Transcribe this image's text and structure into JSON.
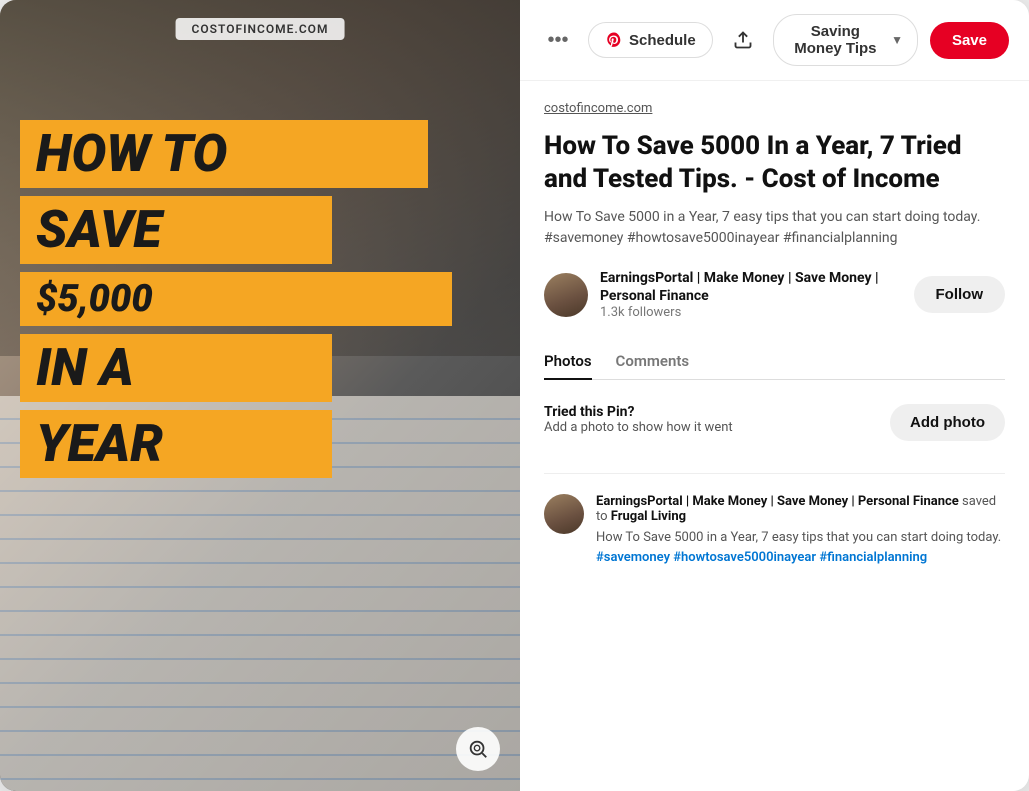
{
  "modal": {
    "image_panel": {
      "site_label": "COSTOFINCOME.COM",
      "text_lines": [
        "HOW TO",
        "SAVE",
        "$5,000",
        "IN A",
        "YEAR"
      ]
    },
    "top_bar": {
      "more_dots": "•••",
      "schedule_label": "Schedule",
      "board_name": "Saving Money Tips",
      "save_label": "Save"
    },
    "source_link": "costofincome.com",
    "pin_title": "How To Save 5000 In a Year, 7 Tried and Tested Tips. - Cost of Income",
    "pin_description": "How To Save 5000 in a Year, 7 easy tips that you can start doing today. #savemoney #howtosave5000inayear #financialplanning",
    "author": {
      "name": "EarningsPortal | Make Money | Save Money | Personal Finance",
      "followers": "1.3k followers"
    },
    "follow_label": "Follow",
    "tabs": [
      {
        "label": "Photos",
        "active": true
      },
      {
        "label": "Comments",
        "active": false
      }
    ],
    "tried_pin": {
      "title": "Tried this Pin?",
      "subtitle": "Add a photo to show how it went",
      "add_photo_label": "Add photo"
    },
    "comment": {
      "author_name": "EarningsPortal | Make Money | Save Money | Personal Finance",
      "action": "saved to",
      "board": "Frugal Living",
      "text": "How To Save 5000 in a Year, 7 easy tips that you can start doing today.",
      "hashtags": [
        "#savemoney",
        "#howtosave5000inayear",
        "#financialplanning"
      ]
    }
  }
}
